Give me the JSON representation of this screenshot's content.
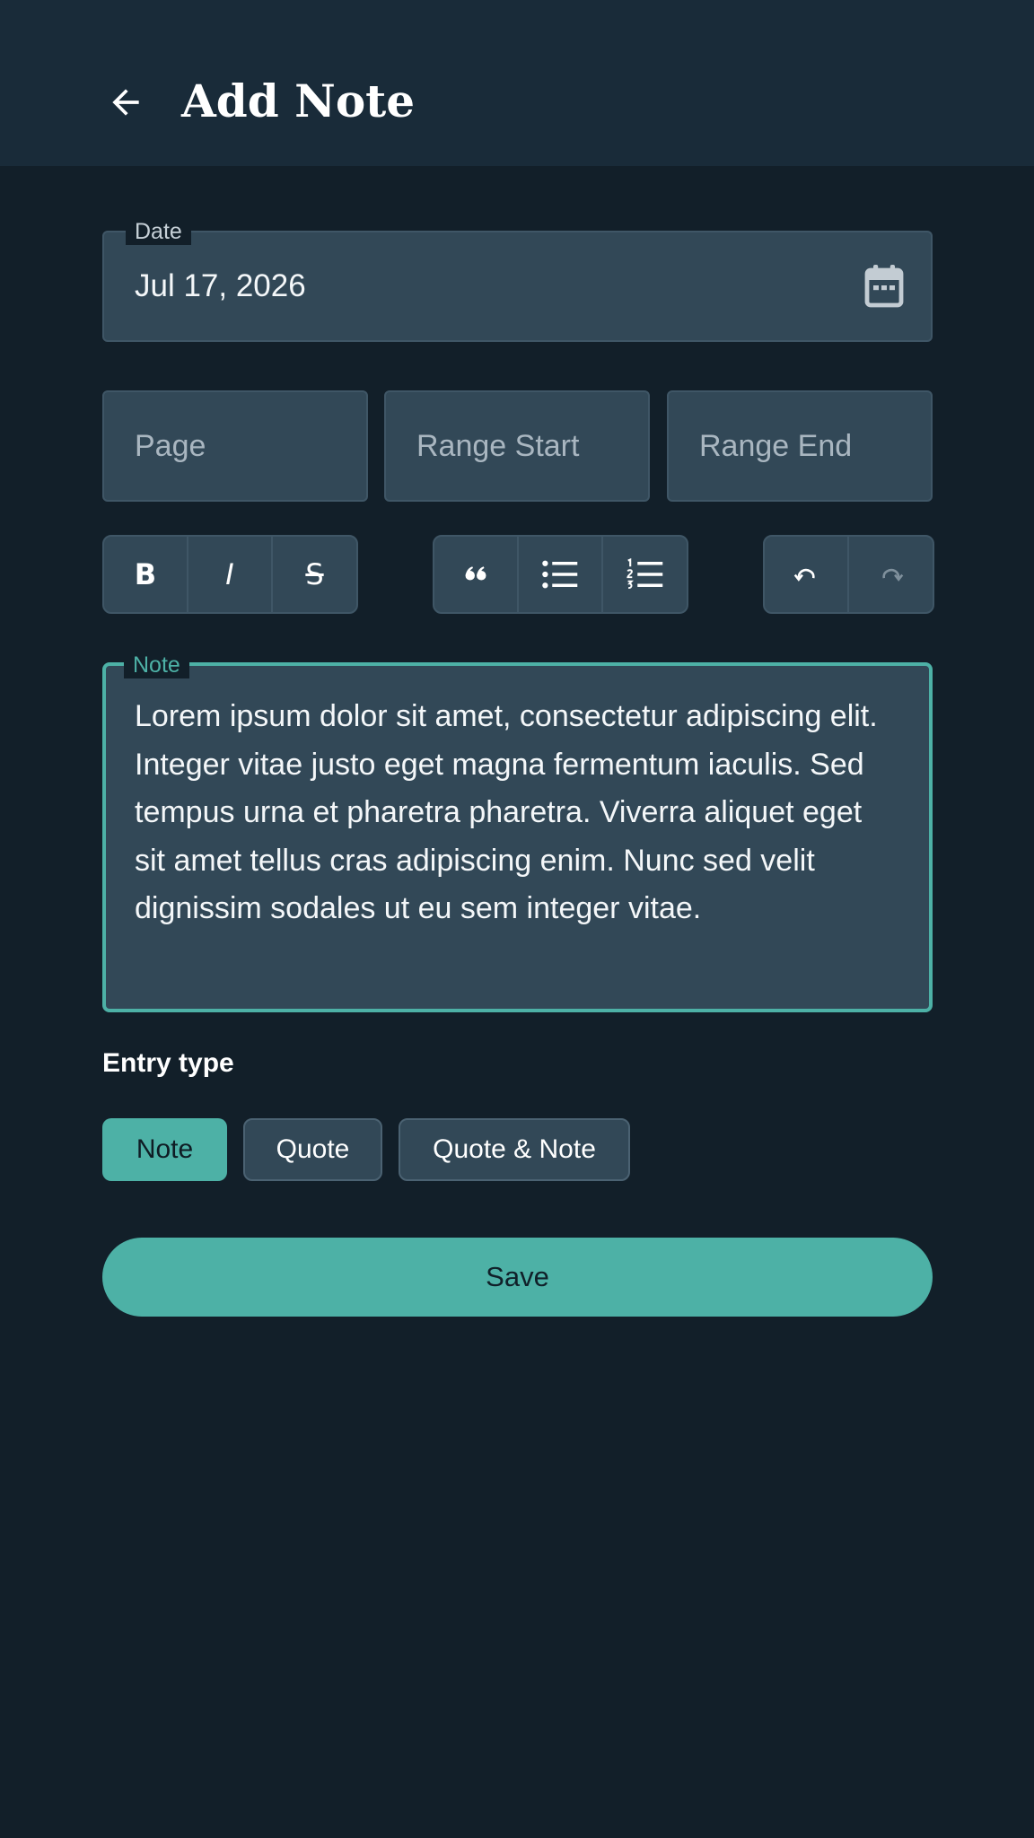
{
  "header": {
    "title": "Add Note"
  },
  "date_field": {
    "label": "Date",
    "value": "Jul 17, 2026"
  },
  "page_field": {
    "placeholder": "Page"
  },
  "range_start_field": {
    "placeholder": "Range Start"
  },
  "range_end_field": {
    "placeholder": "Range End"
  },
  "toolbar": {
    "bold": "B",
    "italic": "I",
    "strikethrough": "S"
  },
  "note_field": {
    "label": "Note",
    "value": "Lorem ipsum dolor sit amet, consectetur adipiscing elit. Integer vitae justo eget magna fermentum iaculis. Sed tempus urna et pharetra pharetra. Viverra aliquet eget sit amet tellus cras adipiscing enim. Nunc sed velit dignissim sodales ut eu sem integer vitae."
  },
  "entry_type": {
    "label": "Entry type",
    "options": [
      "Note",
      "Quote",
      "Quote & Note"
    ],
    "selected": "Note"
  },
  "save_label": "Save",
  "colors": {
    "accent": "#4db1a6",
    "background": "#121f29",
    "app_bar": "#192b39",
    "field": "#324857"
  },
  "icons": {
    "back": "arrow-left-icon",
    "calendar": "calendar-icon",
    "quote": "format-quote-icon",
    "bulleted_list": "bulleted-list-icon",
    "numbered_list": "numbered-list-icon",
    "undo": "undo-icon",
    "redo": "redo-icon"
  }
}
